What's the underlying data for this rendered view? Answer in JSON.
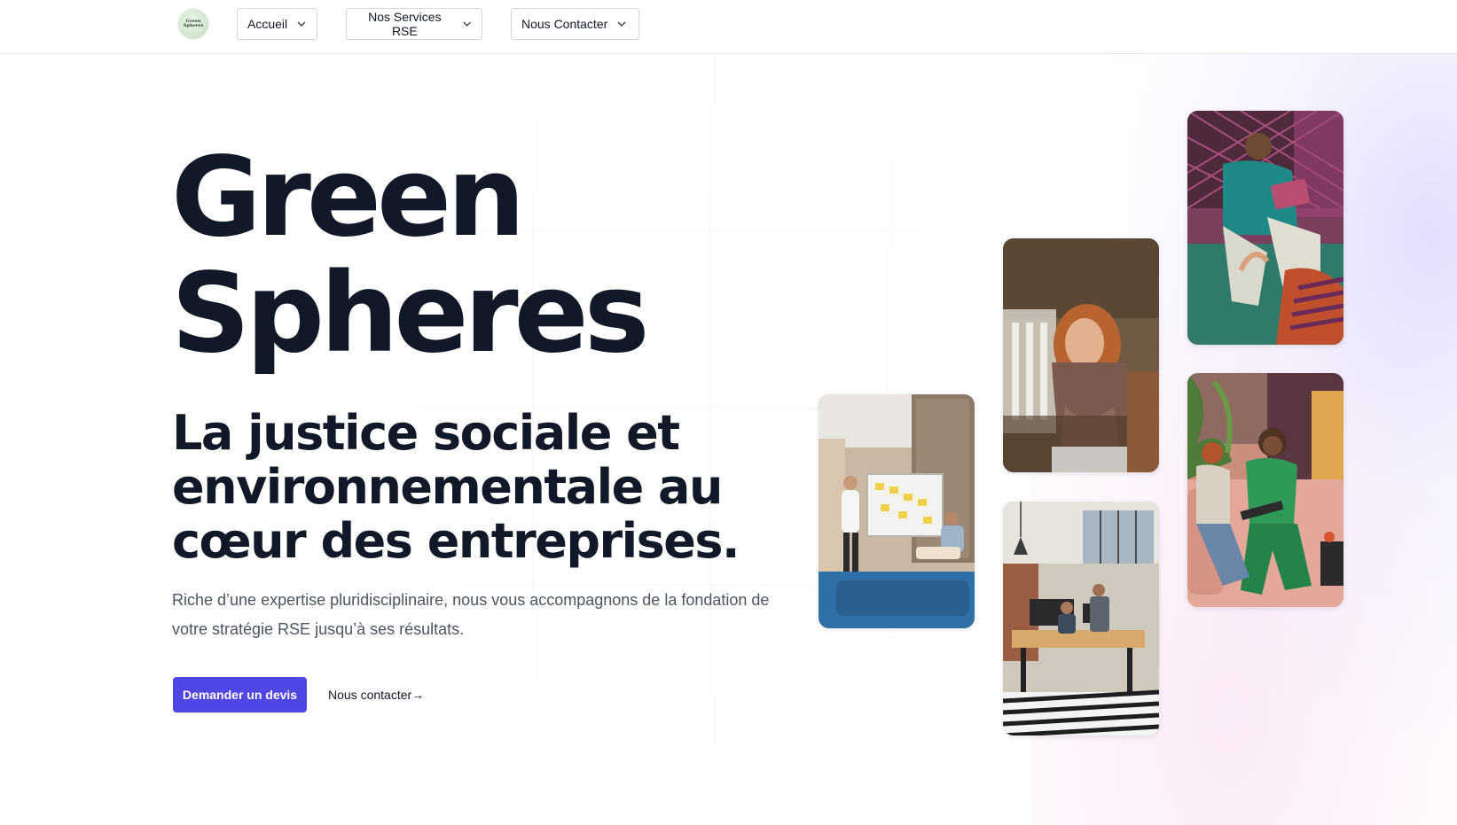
{
  "logo": {
    "lines": [
      "Green",
      "Spheres"
    ]
  },
  "nav": {
    "items": [
      {
        "label": "Accueil"
      },
      {
        "label": "Nos Services RSE"
      },
      {
        "label": "Nous Contacter"
      }
    ]
  },
  "hero": {
    "title_line1": "Green",
    "title_line2": "Spheres",
    "subtitle": "La justice sociale et environnementale au cœur des entreprises.",
    "description": "Riche d’une expertise pluridisciplinaire, nous vous accompagnons de la fondation de votre stratégie RSE jusqu’à ses résultats.",
    "cta_primary": "Demander un devis",
    "cta_secondary": "Nous contacter→"
  },
  "colors": {
    "accent": "#4f46e5",
    "text": "#111827",
    "muted": "#4b5563"
  }
}
